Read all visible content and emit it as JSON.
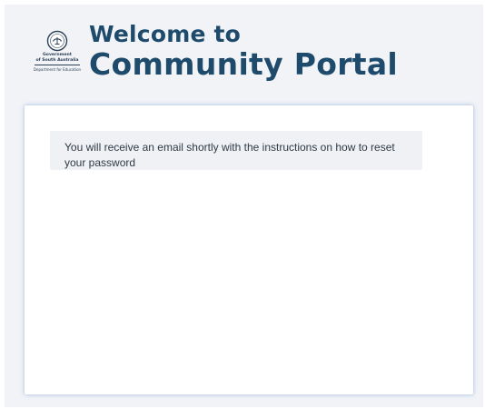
{
  "header": {
    "logo": {
      "icon": "crest-icon",
      "line1": "Government",
      "line2": "of South Australia",
      "department": "Department for Education"
    },
    "title_line1": "Welcome to",
    "title_line2": "Community Portal",
    "brand_color": "#1e4a6b"
  },
  "main": {
    "message": "You will receive an email shortly with the instructions on how to reset your password"
  },
  "colors": {
    "background": "#f1f3f7",
    "card": "#ffffff",
    "message_background": "#eff1f4",
    "text": "#2f3a45"
  }
}
